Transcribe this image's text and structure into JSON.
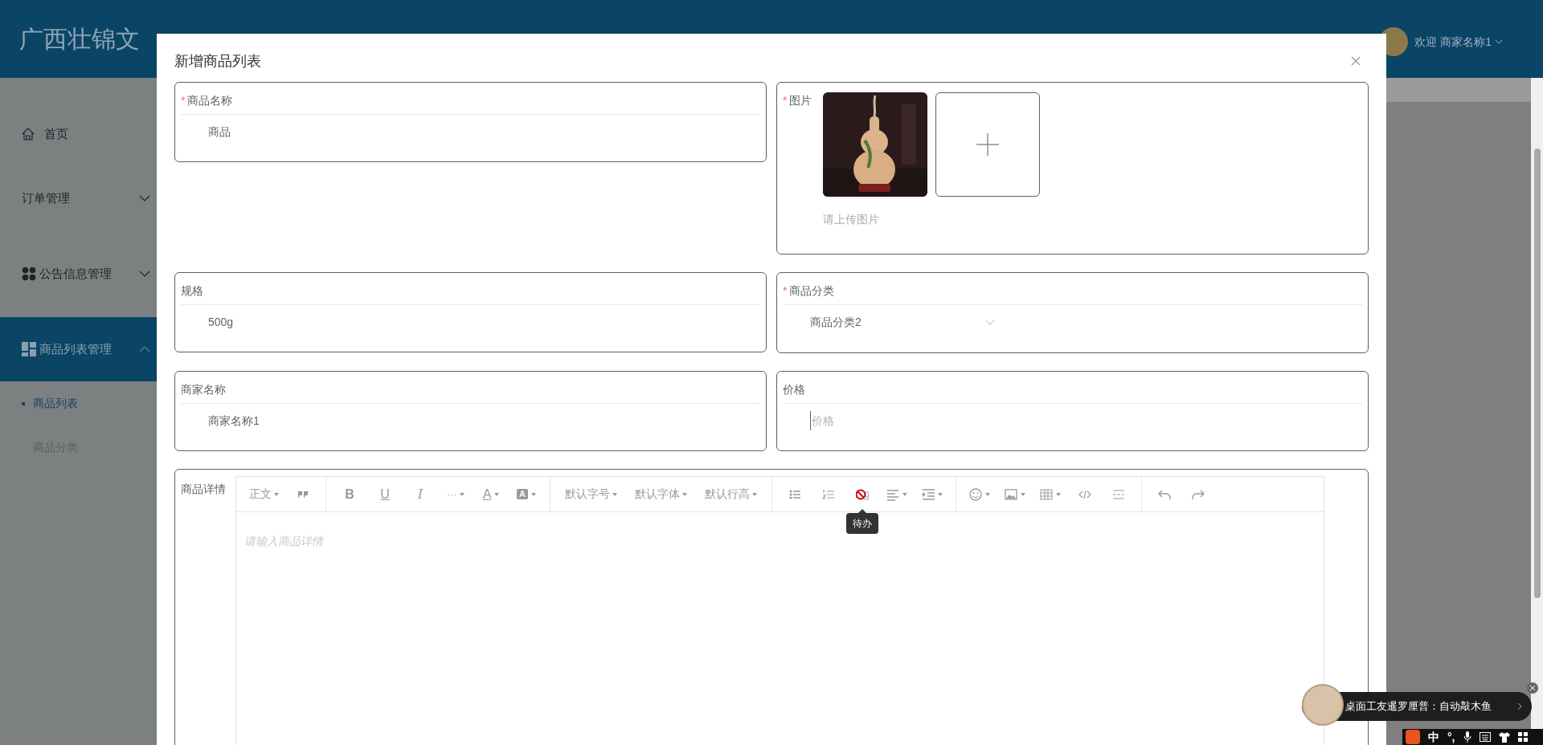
{
  "header": {
    "title": "广西壮锦文",
    "user": "欢迎 商家名称1"
  },
  "sidebar": {
    "items": [
      {
        "label": "首页",
        "kind": "home",
        "selected": false
      },
      {
        "label": "订单管理",
        "kind": "group",
        "expanded": false,
        "selected": false
      },
      {
        "label": "公告信息管理",
        "kind": "group-dots",
        "expanded": false,
        "selected": false
      },
      {
        "label": "商品列表管理",
        "kind": "group-grid",
        "expanded": true,
        "selected": true,
        "children": [
          {
            "label": "商品列表",
            "selected": true
          },
          {
            "label": "商品分类",
            "selected": false
          }
        ]
      }
    ]
  },
  "dialog": {
    "title": "新增商品列表",
    "name": {
      "required_mark": "*",
      "label": "商品名称",
      "value": "商品"
    },
    "image": {
      "required_mark": "*",
      "label": "图片",
      "hint": "请上传图片"
    },
    "spec": {
      "label": "规格",
      "value": "500g"
    },
    "category": {
      "required_mark": "*",
      "label": "商品分类",
      "value": "商品分类2"
    },
    "merchant": {
      "label": "商家名称",
      "value": "商家名称1"
    },
    "price": {
      "label": "价格",
      "placeholder": "价格"
    },
    "details": {
      "label": "商品详情",
      "placeholder": "请输入商品详情",
      "tooltip": "待办",
      "toolbar": [
        [
          {
            "kind": "dropdown",
            "label": "正文"
          },
          {
            "kind": "icon"
          }
        ],
        [
          {
            "kind": "glyph",
            "label": "B"
          },
          {
            "kind": "glyph",
            "label": "U"
          },
          {
            "kind": "glyph",
            "label": "I"
          },
          {
            "kind": "glyph",
            "label": "···"
          },
          {
            "kind": "glyph",
            "label": "A"
          },
          {
            "kind": "glyph",
            "label": "A"
          }
        ],
        [
          {
            "kind": "dropdown",
            "label": "默认字号"
          },
          {
            "kind": "dropdown",
            "label": "默认字体"
          },
          {
            "kind": "dropdown",
            "label": "默认行高"
          }
        ],
        [
          {
            "kind": "icon"
          },
          {
            "kind": "icon"
          },
          {
            "kind": "icon"
          },
          {
            "kind": "icon"
          },
          {
            "kind": "icon"
          }
        ],
        [
          {
            "kind": "icon"
          },
          {
            "kind": "icon"
          },
          {
            "kind": "icon"
          },
          {
            "kind": "icon"
          },
          {
            "kind": "icon"
          }
        ],
        [
          {
            "kind": "icon"
          },
          {
            "kind": "icon"
          }
        ]
      ]
    }
  },
  "notification": {
    "text": "桌面工友暹罗厘普：自动敲木鱼"
  },
  "ime_bar": {
    "mode": "中",
    "punctuation": "°,"
  }
}
